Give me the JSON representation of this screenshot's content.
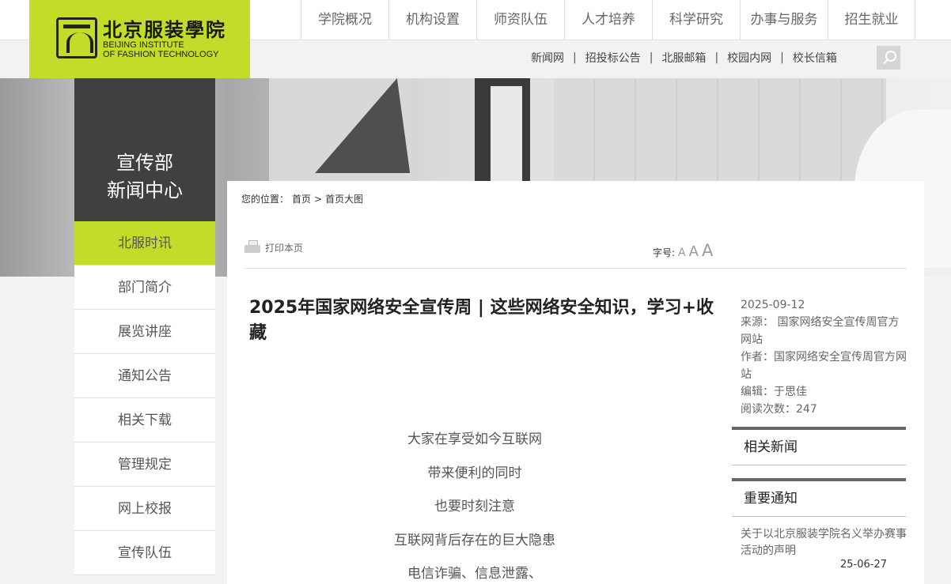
{
  "logo": {
    "cn": "北京服装學院",
    "en_line1": "BEIJING INSTITUTE",
    "en_line2": "OF FASHION TECHNOLOGY"
  },
  "main_nav": [
    "学院概况",
    "机构设置",
    "师资队伍",
    "人才培养",
    "科学研究",
    "办事与服务",
    "招生就业"
  ],
  "sub_nav": [
    "新闻网",
    "招投标公告",
    "北服邮箱",
    "校园内网",
    "校长信箱"
  ],
  "sub_nav_sep": "|",
  "section": {
    "title_line1": "宣传部",
    "title_line2": "新闻中心"
  },
  "side_menu": [
    "北服时讯",
    "部门简介",
    "展览讲座",
    "通知公告",
    "相关下载",
    "管理规定",
    "网上校报",
    "宣传队伍"
  ],
  "breadcrumb": {
    "label": "您的位置：",
    "home": "首页",
    "sep": ">",
    "current": "首页大图"
  },
  "toolbar": {
    "print": "打印本页",
    "fontsize_label": "字号:",
    "size_small": "A",
    "size_medium": "A",
    "size_large": "A"
  },
  "article": {
    "title": "2025年国家网络安全宣传周 | 这些网络安全知识，学习+收藏",
    "paragraphs": [
      "大家在享受如今互联网",
      "带来便利的同时",
      "也要时刻注意",
      "互联网背后存在的巨大隐患",
      "电信诈骗、信息泄露、"
    ]
  },
  "meta": {
    "date": "2025-09-12",
    "source": "来源： 国家网络安全宣传周官方网站",
    "author": "作者：国家网络安全宣传周官方网站",
    "editor": "编辑：于思佳",
    "views": "阅读次数：247"
  },
  "related_news": {
    "title": "相关新闻"
  },
  "notices": {
    "title": "重要通知",
    "items": [
      {
        "text": "关于以北京服装学院名义举办赛事活动的声明",
        "date": "25-06-27"
      }
    ]
  }
}
